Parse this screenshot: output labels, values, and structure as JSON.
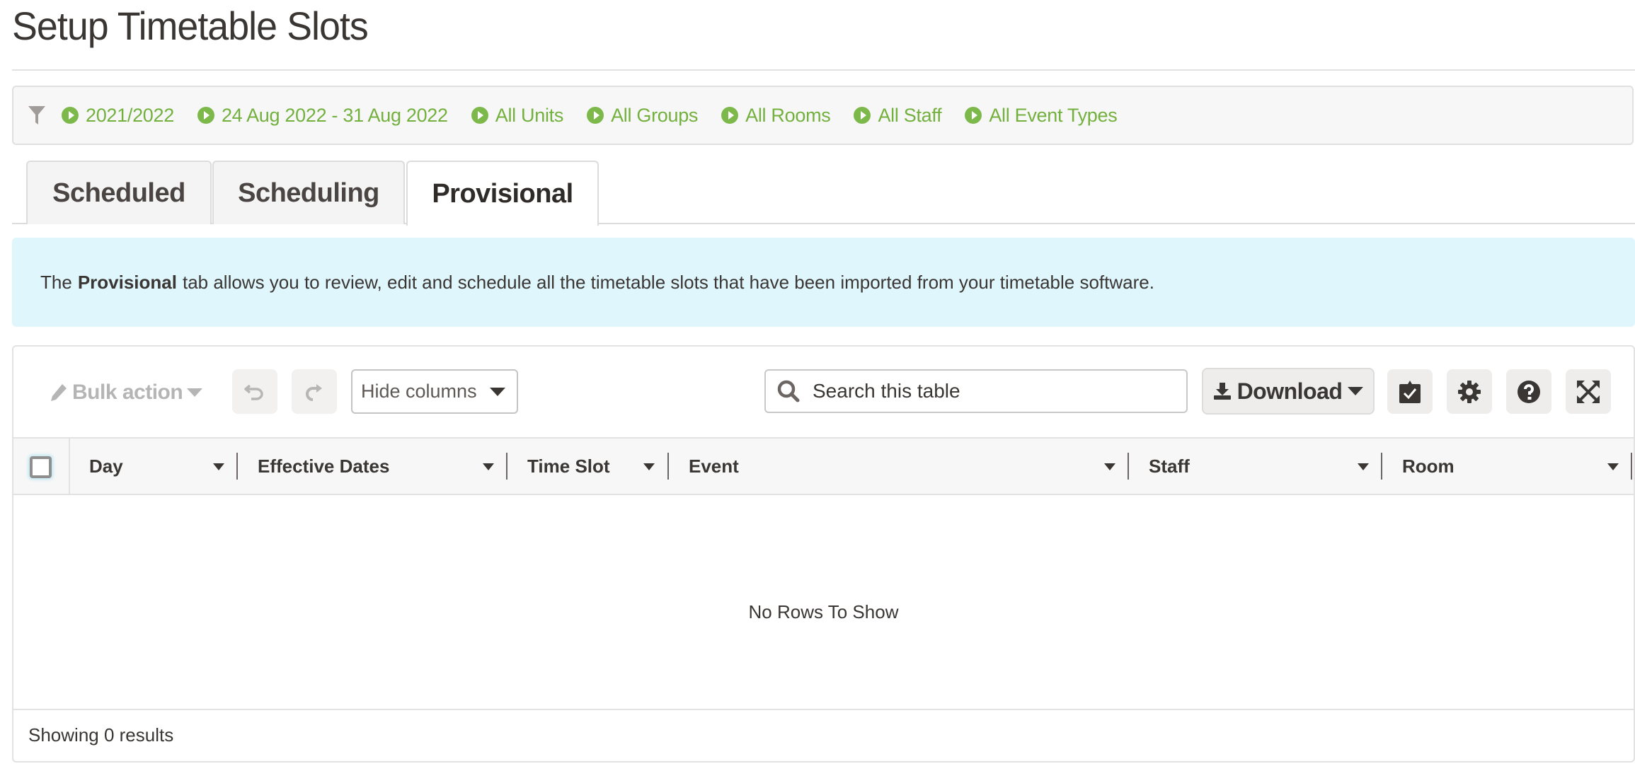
{
  "page": {
    "title": "Setup Timetable Slots"
  },
  "filters": {
    "icon": "filter-icon",
    "chips": [
      {
        "label": "2021/2022"
      },
      {
        "label": "24 Aug 2022 - 31 Aug 2022"
      },
      {
        "label": "All Units"
      },
      {
        "label": "All Groups"
      },
      {
        "label": "All Rooms"
      },
      {
        "label": "All Staff"
      },
      {
        "label": "All Event Types"
      }
    ]
  },
  "tabs": [
    {
      "label": "Scheduled",
      "active": false
    },
    {
      "label": "Scheduling",
      "active": false
    },
    {
      "label": "Provisional",
      "active": true
    }
  ],
  "info": {
    "prefix": "The",
    "bold": "Provisional",
    "suffix": "tab allows you to review, edit and schedule all the timetable slots that have been imported from your timetable software."
  },
  "toolbar": {
    "bulk_action_label": "Bulk action",
    "undo_icon": "undo-icon",
    "redo_icon": "redo-icon",
    "hide_columns_label": "Hide columns",
    "search_placeholder": "Search this table",
    "search_value": "",
    "download_label": "Download",
    "icon_buttons": [
      "task-check-icon",
      "gear-icon",
      "help-icon",
      "fullscreen-icon"
    ]
  },
  "table": {
    "columns": [
      {
        "label": "Day"
      },
      {
        "label": "Effective Dates"
      },
      {
        "label": "Time Slot"
      },
      {
        "label": "Event"
      },
      {
        "label": "Staff"
      },
      {
        "label": "Room"
      }
    ],
    "rows": [],
    "empty_message": "No Rows To Show",
    "results_text": "Showing 0 results"
  },
  "colors": {
    "accent_green": "#73b03e",
    "info_bg": "#dff6fc",
    "text": "#3a3634"
  }
}
